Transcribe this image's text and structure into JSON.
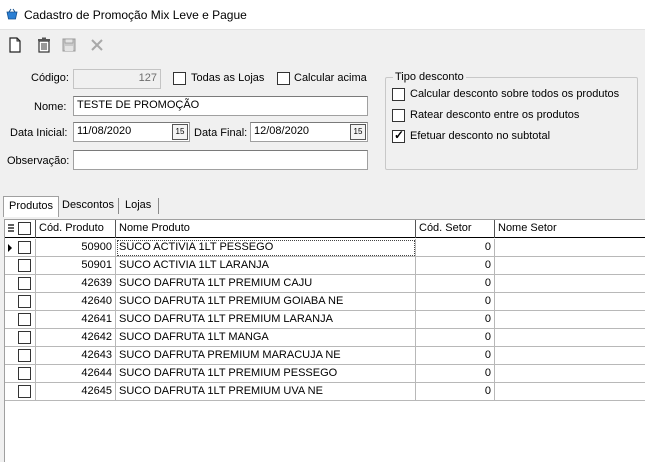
{
  "window": {
    "title": "Cadastro de Promoção Mix Leve e Pague",
    "icon": "basket-icon"
  },
  "toolbar": {
    "buttons": [
      "new-document-icon",
      "trash-icon",
      "save-icon",
      "cancel-icon"
    ]
  },
  "form": {
    "codigo_label": "Código:",
    "codigo_value": "127",
    "todas_lojas_label": "Todas as Lojas",
    "todas_lojas_checked": false,
    "calcular_acima_label": "Calcular acima",
    "calcular_acima_checked": false,
    "nome_label": "Nome:",
    "nome_value": "TESTE DE PROMOÇÃO",
    "data_inicial_label": "Data Inicial:",
    "data_inicial_value": "11/08/2020",
    "data_final_label": "Data Final:",
    "data_final_value": "12/08/2020",
    "observacao_label": "Observação:",
    "observacao_value": "",
    "calendar_button_glyph": "15"
  },
  "tipo_desconto": {
    "title": "Tipo desconto",
    "options": [
      {
        "label": "Calcular desconto sobre todos os produtos",
        "checked": false
      },
      {
        "label": "Ratear desconto entre os produtos",
        "checked": false
      },
      {
        "label": "Efetuar desconto no subtotal",
        "checked": true
      }
    ]
  },
  "tabs": [
    {
      "label": "Produtos",
      "active": true
    },
    {
      "label": "Descontos",
      "active": false
    },
    {
      "label": "Lojas",
      "active": false
    }
  ],
  "grid": {
    "columns": [
      "Cód. Produto",
      "Nome Produto",
      "Cód. Setor",
      "Nome Setor"
    ],
    "rows": [
      {
        "cod": "50900",
        "nome": "SUCO ACTIVIA 1LT PESSEGO",
        "setor": "0",
        "nome_setor": ""
      },
      {
        "cod": "50901",
        "nome": "SUCO ACTIVIA 1LT LARANJA",
        "setor": "0",
        "nome_setor": ""
      },
      {
        "cod": "42639",
        "nome": "SUCO DAFRUTA 1LT PREMIUM CAJU",
        "setor": "0",
        "nome_setor": ""
      },
      {
        "cod": "42640",
        "nome": "SUCO DAFRUTA 1LT PREMIUM GOIABA NE",
        "setor": "0",
        "nome_setor": ""
      },
      {
        "cod": "42641",
        "nome": "SUCO DAFRUTA 1LT PREMIUM LARANJA",
        "setor": "0",
        "nome_setor": ""
      },
      {
        "cod": "42642",
        "nome": "SUCO DAFRUTA 1LT MANGA",
        "setor": "0",
        "nome_setor": ""
      },
      {
        "cod": "42643",
        "nome": "SUCO DAFRUTA PREMIUM MARACUJA NE",
        "setor": "0",
        "nome_setor": ""
      },
      {
        "cod": "42644",
        "nome": "SUCO DAFRUTA 1LT PREMIUM PESSEGO",
        "setor": "0",
        "nome_setor": ""
      },
      {
        "cod": "42645",
        "nome": "SUCO DAFRUTA 1LT PREMIUM UVA NE",
        "setor": "0",
        "nome_setor": ""
      }
    ]
  }
}
